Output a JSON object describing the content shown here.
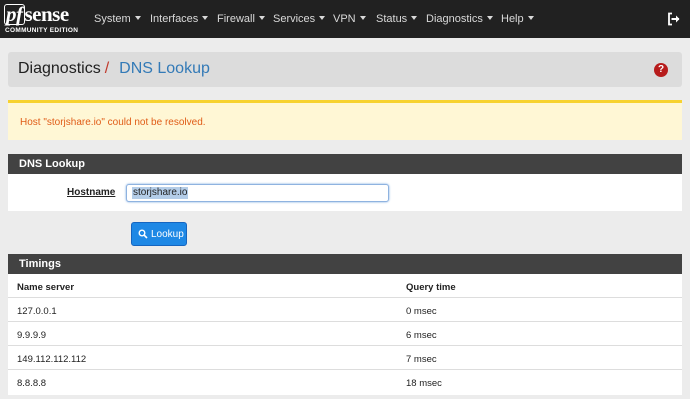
{
  "brand": {
    "name_pf": "pf",
    "name_rest": "sense",
    "edition": "COMMUNITY EDITION"
  },
  "nav": {
    "items": [
      {
        "label": "System"
      },
      {
        "label": "Interfaces"
      },
      {
        "label": "Firewall"
      },
      {
        "label": "Services"
      },
      {
        "label": "VPN"
      },
      {
        "label": "Status"
      },
      {
        "label": "Diagnostics"
      },
      {
        "label": "Help"
      }
    ]
  },
  "breadcrumb": {
    "section": "Diagnostics",
    "separator": "/",
    "page": "DNS Lookup",
    "help": "?"
  },
  "alert": {
    "message": "Host \"storjshare.io\" could not be resolved."
  },
  "lookup_panel": {
    "title": "DNS Lookup",
    "hostname_label": "Hostname",
    "hostname_value": "storjshare.io",
    "button_label": "Lookup"
  },
  "timings": {
    "title": "Timings",
    "columns": [
      "Name server",
      "Query time"
    ],
    "rows": [
      {
        "server": "127.0.0.1",
        "time": "0 msec"
      },
      {
        "server": "9.9.9.9",
        "time": "6 msec"
      },
      {
        "server": "149.112.112.112",
        "time": "7 msec"
      },
      {
        "server": "8.8.8.8",
        "time": "18 msec"
      }
    ]
  },
  "colors": {
    "navbar": "#212121",
    "accent_blue": "#337ab7",
    "alert_bg": "#fff7d5",
    "alert_border": "#f7d22f",
    "alert_text": "#e05c17",
    "button": "#1e88e5",
    "panel_header": "#424242"
  },
  "icons": {
    "logout": "sign-out-icon",
    "help": "question-circle-icon",
    "search": "search-icon"
  }
}
